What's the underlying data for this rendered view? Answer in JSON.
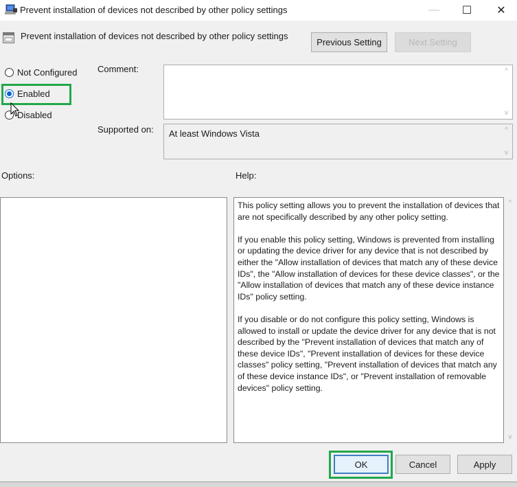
{
  "window": {
    "title": "Prevent installation of devices not described by other policy settings",
    "icon": "group-policy-computer-icon",
    "controls": {
      "minimize": "—",
      "maximize": "☐",
      "close": "✕"
    }
  },
  "header": {
    "setting_title": "Prevent installation of devices not described by other policy settings",
    "setting_icon": "policy-setting-icon",
    "previous_label": "Previous Setting",
    "next_label": "Next Setting",
    "next_enabled": false
  },
  "state": {
    "options": [
      {
        "label": "Not Configured",
        "checked": false
      },
      {
        "label": "Enabled",
        "checked": true
      },
      {
        "label": "Disabled",
        "checked": false
      }
    ],
    "selected": "Enabled"
  },
  "fields": {
    "comment_label": "Comment:",
    "comment_value": "",
    "supported_label": "Supported on:",
    "supported_value": "At least Windows Vista"
  },
  "panels": {
    "options_label": "Options:",
    "help_label": "Help:",
    "help_paragraphs": [
      "This policy setting allows you to prevent the installation of devices that are not specifically described by any other policy setting.",
      "If you enable this policy setting, Windows is prevented from installing or updating the device driver for any device that is not described by either the \"Allow installation of devices that match any of these device IDs\", the \"Allow installation of devices for these device classes\", or the \"Allow installation of devices that match any of these device instance IDs\" policy setting.",
      "If you disable or do not configure this policy setting, Windows is allowed to install or update the device driver for any device that is not described by the \"Prevent installation of devices that match any of these device IDs\", \"Prevent installation of devices for these device classes\" policy setting, \"Prevent installation of devices that match any of these device instance IDs\", or \"Prevent installation of removable devices\" policy setting."
    ]
  },
  "footer": {
    "ok_label": "OK",
    "cancel_label": "Cancel",
    "apply_label": "Apply"
  },
  "annotations": {
    "highlight_color": "#21a84a",
    "highlighted": [
      "Enabled",
      "OK"
    ]
  },
  "scroll_glyphs": {
    "up": "^",
    "down": "v"
  }
}
